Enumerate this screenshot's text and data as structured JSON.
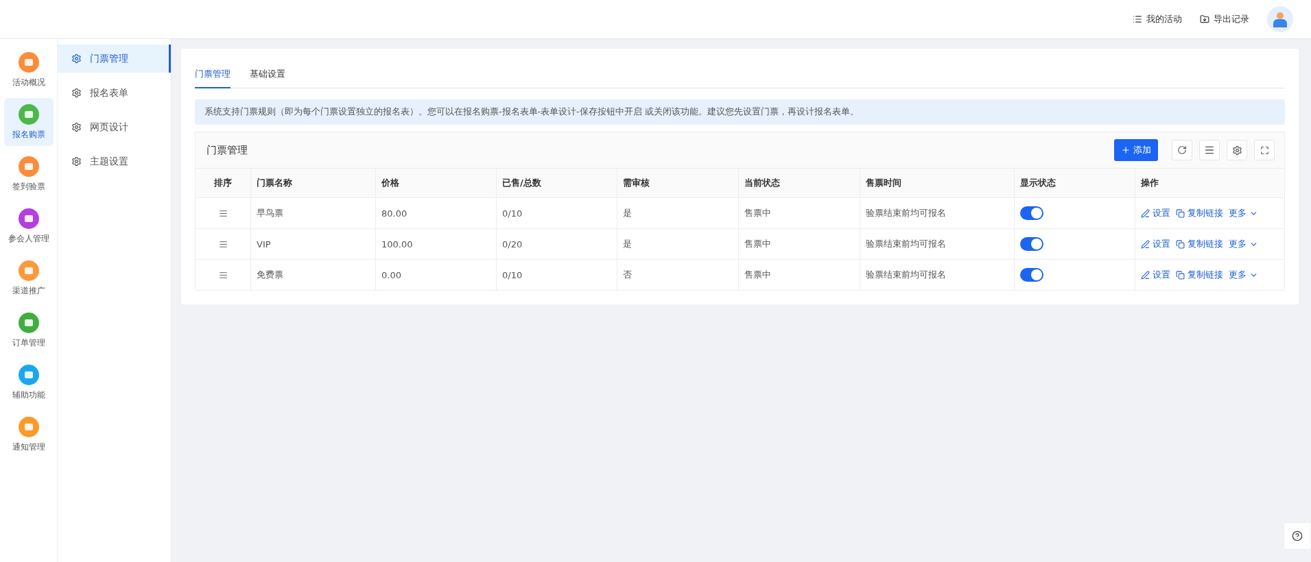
{
  "header": {
    "links": [
      {
        "kind": "list",
        "label": "我的活动"
      },
      {
        "kind": "export",
        "label": "导出记录"
      }
    ]
  },
  "rail": [
    {
      "label": "活动概况",
      "color": "#fb8c3a",
      "selected": false
    },
    {
      "label": "报名购票",
      "color": "#4cb84a",
      "selected": true
    },
    {
      "label": "签到验票",
      "color": "#fb8c3a",
      "selected": false
    },
    {
      "label": "参会人管理",
      "color": "#b43ee0",
      "selected": false
    },
    {
      "label": "渠道推广",
      "color": "#fb9a3a",
      "selected": false
    },
    {
      "label": "订单管理",
      "color": "#3fae3f",
      "selected": false
    },
    {
      "label": "辅助功能",
      "color": "#1aa7f0",
      "selected": false
    },
    {
      "label": "通知管理",
      "color": "#fb9a2a",
      "selected": false
    }
  ],
  "submenu": [
    {
      "label": "门票管理",
      "selected": true
    },
    {
      "label": "报名表单",
      "selected": false
    },
    {
      "label": "网页设计",
      "selected": false
    },
    {
      "label": "主题设置",
      "selected": false
    }
  ],
  "tabs": [
    {
      "label": "门票管理",
      "selected": true
    },
    {
      "label": "基础设置",
      "selected": false
    }
  ],
  "notice": "系统支持门票规则（即为每个门票设置独立的报名表）。您可以在报名购票-报名表单-表单设计-保存按钮中开启 或关闭该功能。建议您先设置门票，再设计报名表单。",
  "table": {
    "title": "门票管理",
    "add_button": "添加",
    "columns": [
      "排序",
      "门票名称",
      "价格",
      "已售/总数",
      "需审核",
      "当前状态",
      "售票时间",
      "显示状态",
      "操作"
    ],
    "rows": [
      {
        "name": "早鸟票",
        "price": "80.00",
        "sold": "0/10",
        "review": "是",
        "status": "售票中",
        "time": "验票结束前均可报名",
        "on": true,
        "actions": [
          "设置",
          "复制链接",
          "更多"
        ]
      },
      {
        "name": "VIP",
        "price": "100.00",
        "sold": "0/20",
        "review": "是",
        "status": "售票中",
        "time": "验票结束前均可报名",
        "on": true,
        "actions": [
          "设置",
          "复制链接",
          "更多"
        ]
      },
      {
        "name": "免费票",
        "price": "0.00",
        "sold": "0/10",
        "review": "否",
        "status": "售票中",
        "time": "验票结束前均可报名",
        "on": true,
        "actions": [
          "设置",
          "复制链接",
          "更多"
        ]
      }
    ]
  }
}
